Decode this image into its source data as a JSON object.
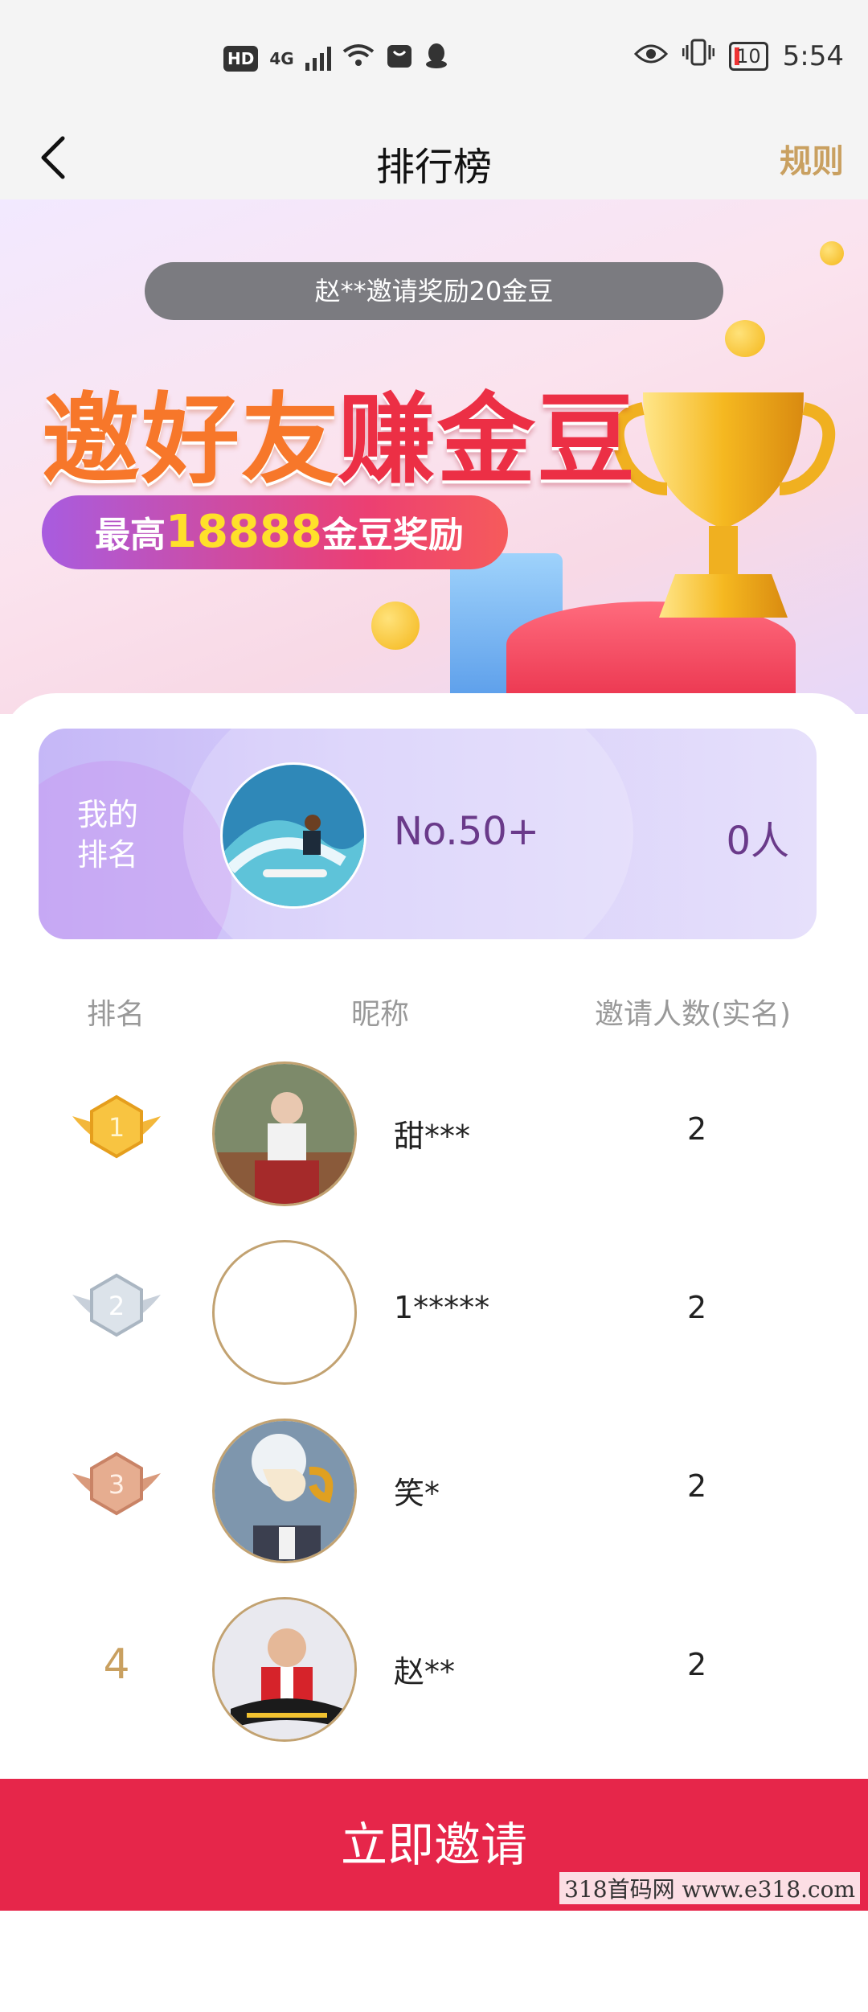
{
  "status_bar": {
    "hd": "HD",
    "network": "4G",
    "battery": "10",
    "time": "5:54"
  },
  "header": {
    "title": "排行榜",
    "rule": "规则"
  },
  "banner": {
    "notice": "赵**邀请奖励20金豆",
    "slogan_left": "邀好友",
    "slogan_right": "赚金豆",
    "pill_prefix": "最高",
    "pill_amount": "18888",
    "pill_suffix": "金豆奖励"
  },
  "my_rank": {
    "label": "我的排名",
    "rank": "No.50+",
    "count": "0人"
  },
  "table": {
    "headers": [
      "排名",
      "昵称",
      "邀请人数(实名)"
    ],
    "rows": [
      {
        "rank": "1",
        "nickname": "甜***",
        "count": "2"
      },
      {
        "rank": "2",
        "nickname": "1*****",
        "count": "2"
      },
      {
        "rank": "3",
        "nickname": "笑*",
        "count": "2"
      },
      {
        "rank": "4",
        "nickname": "赵**",
        "count": "2"
      }
    ]
  },
  "cta": "立即邀请",
  "watermark": "318首码网  www.e318.com",
  "colors": {
    "cta": "#e6264a",
    "gold": "#c9a060",
    "rank_text": "#6a3a8a"
  }
}
